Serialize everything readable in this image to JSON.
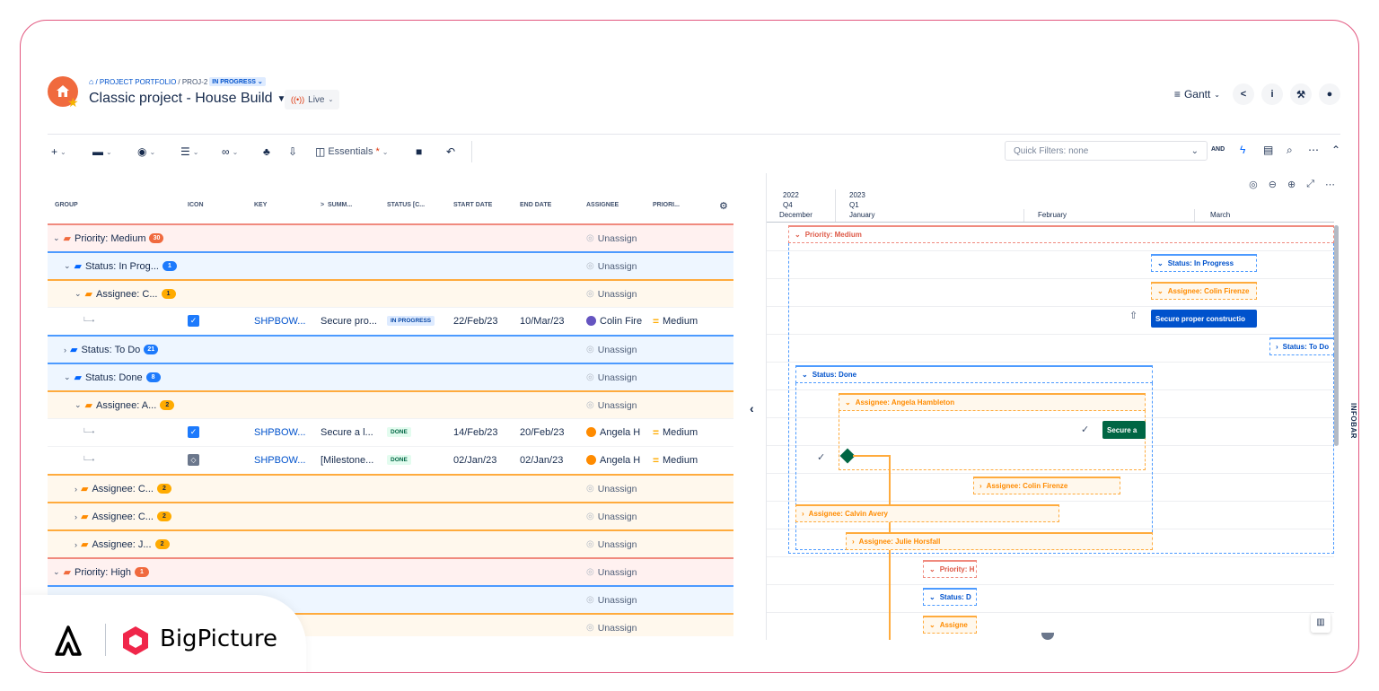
{
  "breadcrumb": {
    "portfolio": "/ PROJECT PORTFOLIO",
    "key": "/ PROJ-2",
    "status": "IN PROGRESS"
  },
  "project": {
    "title": "Classic project - House Build",
    "live": "Live"
  },
  "header": {
    "view": "Gantt",
    "info": "i"
  },
  "toolbar": {
    "essentials": "Essentials",
    "essentials_star": "*",
    "quick_filters": "Quick Filters: none",
    "and": "AND"
  },
  "columns": [
    "GROUP",
    "ICON",
    "KEY",
    "SUMM...",
    "STATUS [C...",
    "START DATE",
    "END DATE",
    "ASSIGNEE",
    "PRIORI..."
  ],
  "rows": [
    {
      "type": "pri",
      "label": "Priority: Medium",
      "count": "30",
      "assignee": "Unassign"
    },
    {
      "type": "stat",
      "label": "Status: In Prog...",
      "count": "1",
      "assignee": "Unassign"
    },
    {
      "type": "asg",
      "label": "Assignee: C...",
      "count": "1",
      "assignee": "Unassign"
    },
    {
      "type": "task",
      "key": "SHPBOW...",
      "summary": "Secure pro...",
      "status": "IN PROGRESS",
      "start": "22/Feb/23",
      "end": "10/Mar/23",
      "assignee": "Colin Fire",
      "priority": "Medium"
    },
    {
      "type": "stat",
      "label": "Status: To Do",
      "count": "21",
      "assignee": "Unassign"
    },
    {
      "type": "stat",
      "label": "Status: Done",
      "count": "8",
      "assignee": "Unassign"
    },
    {
      "type": "asg",
      "label": "Assignee: A...",
      "count": "2",
      "assignee": "Unassign"
    },
    {
      "type": "task",
      "key": "SHPBOW...",
      "summary": "Secure a l...",
      "status": "DONE",
      "start": "14/Feb/23",
      "end": "20/Feb/23",
      "assignee": "Angela H",
      "priority": "Medium"
    },
    {
      "type": "task",
      "key": "SHPBOW...",
      "summary": "[Milestone...",
      "status": "DONE",
      "start": "02/Jan/23",
      "end": "02/Jan/23",
      "assignee": "Angela H",
      "priority": "Medium"
    },
    {
      "type": "asg",
      "label": "Assignee: C...",
      "count": "2",
      "assignee": "Unassign"
    },
    {
      "type": "asg",
      "label": "Assignee: C...",
      "count": "2",
      "assignee": "Unassign"
    },
    {
      "type": "asg",
      "label": "Assignee: J...",
      "count": "2",
      "assignee": "Unassign"
    },
    {
      "type": "pri",
      "label": "Priority: High",
      "count": "1",
      "assignee": "Unassign"
    },
    {
      "type": "stat",
      "label": "",
      "count": "",
      "assignee": "Unassign"
    },
    {
      "type": "asg",
      "label": "",
      "count": "",
      "assignee": "Unassign"
    }
  ],
  "timeline": {
    "year1": "2022",
    "year2": "2023",
    "q1": "Q4",
    "q2": "Q1",
    "m_dec": "December",
    "m_jan": "January",
    "m_feb": "February",
    "m_mar": "March"
  },
  "gantt_bars": {
    "priority_medium": "Priority: Medium",
    "status_in_progress": "Status: In Progress",
    "assignee_colin": "Assignee: Colin Firenze",
    "task_secure": "Secure proper constructio",
    "status_todo": "Status: To Do",
    "status_done": "Status: Done",
    "assignee_angela": "Assignee: Angela Hambleton",
    "task_secure_a": "Secure a",
    "assignee_colin2": "Assignee: Colin Firenze",
    "assignee_calvin": "Assignee: Calvin Avery",
    "assignee_julie": "Assignee: Julie Horsfall",
    "priority_high": "Priority: H",
    "status_d": "Status: D",
    "assignee_short": "Assigne"
  },
  "infobar": "INFOBAR",
  "brand": {
    "name": "BigPicture"
  },
  "colors": {
    "accent": "#0052cc",
    "priority": "#f08a7e",
    "status": "#4c9aff",
    "assignee": "#ffab3d",
    "done": "#006644",
    "brand_border": "#e2577f"
  }
}
